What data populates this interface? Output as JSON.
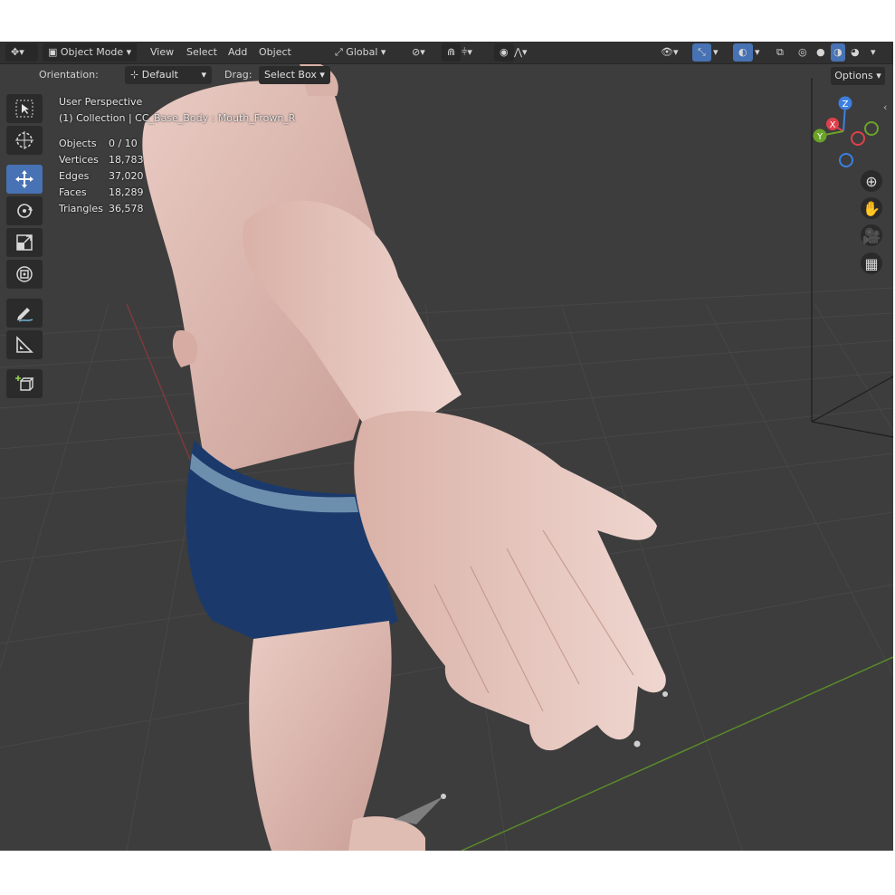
{
  "header": {
    "editor_type_icon": "3d-viewport-icon",
    "mode": "Object Mode",
    "menus": [
      "View",
      "Select",
      "Add",
      "Object"
    ],
    "transform_orientation": "Global",
    "shading_modes": [
      "wireframe",
      "solid",
      "material",
      "rendered"
    ]
  },
  "tool_header": {
    "orientation_label": "Orientation:",
    "orientation_value": "Default",
    "drag_label": "Drag:",
    "drag_value": "Select Box",
    "options_label": "Options"
  },
  "overlay": {
    "view_name": "User Perspective",
    "collection_line": "(1) Collection | CC_Base_Body : Mouth_Frown_R"
  },
  "stats": [
    {
      "label": "Objects",
      "value": "0 / 10"
    },
    {
      "label": "Vertices",
      "value": "18,783"
    },
    {
      "label": "Edges",
      "value": "37,020"
    },
    {
      "label": "Faces",
      "value": "18,289"
    },
    {
      "label": "Triangles",
      "value": "36,578"
    }
  ],
  "toolbar": [
    "select-box-icon",
    "cursor-icon",
    "move-icon",
    "rotate-icon",
    "scale-icon",
    "transform-icon",
    "annotate-icon",
    "measure-icon",
    "add-cube-icon"
  ],
  "gizmo": {
    "z": "Z",
    "x": "X",
    "y": "Y"
  },
  "colors": {
    "viewport_bg": "#3d3d3d",
    "header_bg": "#303030",
    "active_tool": "#4772b3",
    "axis_x": "#e0404a",
    "axis_y": "#6ba329",
    "axis_z": "#3d7fe0"
  }
}
